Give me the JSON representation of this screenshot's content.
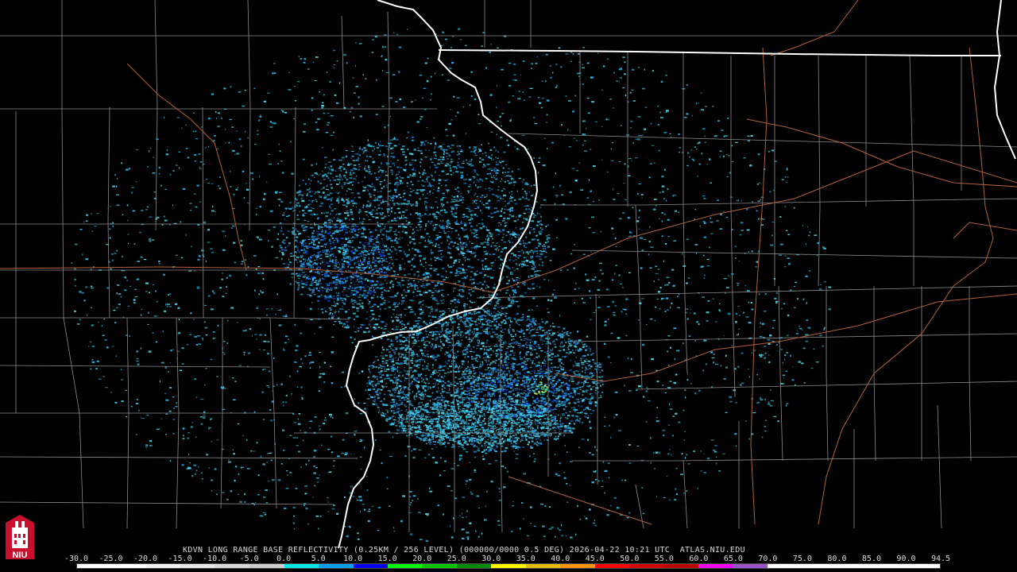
{
  "product_caption": "KDVN LONG RANGE BASE REFLECTIVITY (0.25KM / 256 LEVEL) (000000/0000 0.5 DEG) 2026-04-22 10:21 UTC  ATLAS.NIU.EDU",
  "colorbar": {
    "tick_labels": [
      "-30.0",
      "-25.0",
      "-20.0",
      "-15.0",
      "-10.0",
      "-5.0",
      "0.0",
      "5.0",
      "10.0",
      "15.0",
      "20.0",
      "25.0",
      "30.0",
      "35.0",
      "40.0",
      "45.0",
      "50.0",
      "55.0",
      "60.0",
      "65.0",
      "70.0",
      "75.0",
      "80.0",
      "85.0",
      "90.0",
      "94.5"
    ],
    "colors": [
      "#ffffff",
      "#ffffff",
      "#f2f2f2",
      "#e6e6e6",
      "#d9d9d9",
      "#cccccc",
      "#04e9e7",
      "#019ff4",
      "#0300f4",
      "#02fd02",
      "#01c501",
      "#008e00",
      "#fdf802",
      "#e5bc00",
      "#fd9500",
      "#fd0000",
      "#d40000",
      "#bc0000",
      "#f800fd",
      "#9854c6",
      "#fdfdfd",
      "#fdfdfd",
      "#fdfdfd",
      "#fdfdfd",
      "#fdfdfd"
    ]
  },
  "logo": {
    "text": "NIU",
    "colors": {
      "red": "#c8102e",
      "white": "#ffffff"
    }
  },
  "map": {
    "state_border_color": "#ffffff",
    "county_border_color": "#8c8c8c",
    "highway_color": "#b0603a",
    "echo_colors": [
      "#4fd4e8",
      "#2bb5e0",
      "#1f7fd6",
      "#0b3ad0",
      "#3de07a",
      "#e8e83a"
    ]
  }
}
